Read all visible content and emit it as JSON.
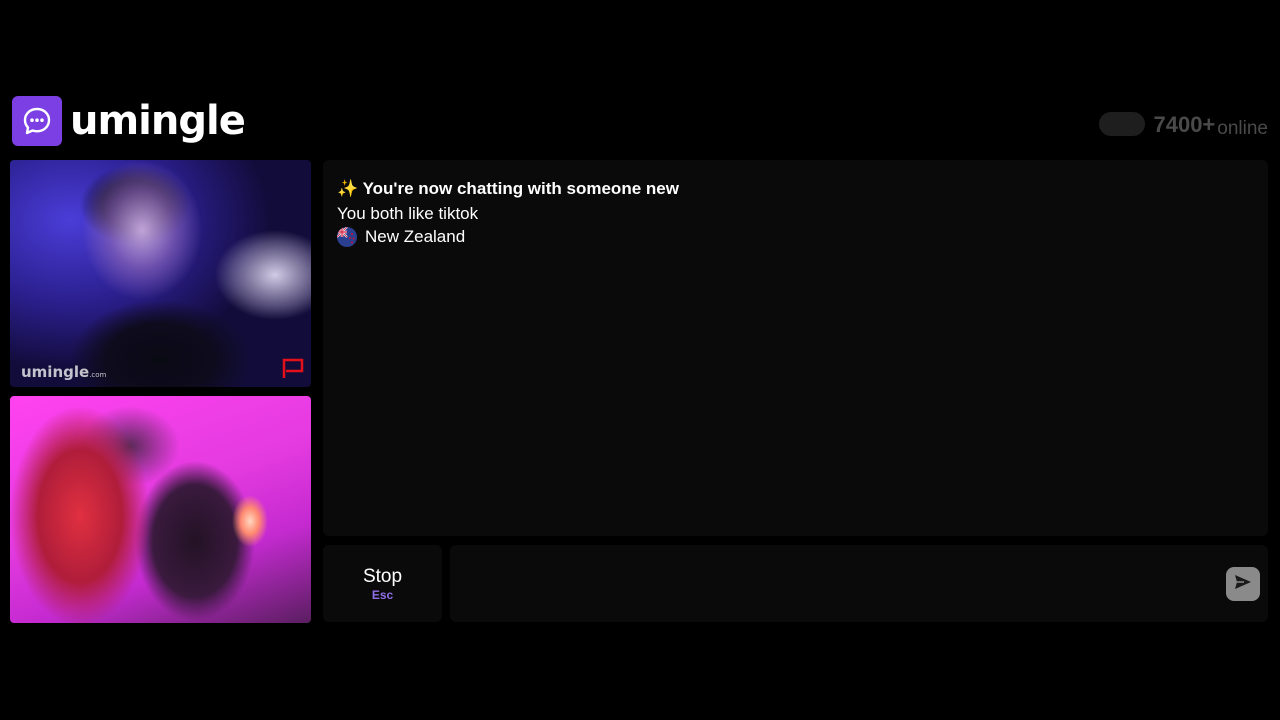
{
  "header": {
    "logo_text": "umingle",
    "online_count": "7400+",
    "online_label": "online"
  },
  "video": {
    "watermark_main": "umingle",
    "watermark_suffix": ".com"
  },
  "chat": {
    "title": "✨ You're now chatting with someone new",
    "interest": "You both like tiktok",
    "country": "New Zealand"
  },
  "controls": {
    "stop_label": "Stop",
    "stop_hint": "Esc",
    "message_placeholder": ""
  },
  "colors": {
    "brand_purple": "#7b3fe4",
    "hint_purple": "#8e6fe8",
    "flag_red": "#e3101a"
  },
  "icons": {
    "logo": "chat-bubble-icon",
    "report": "flag-icon",
    "send": "send-icon",
    "country_flag": "new-zealand-flag-icon"
  }
}
